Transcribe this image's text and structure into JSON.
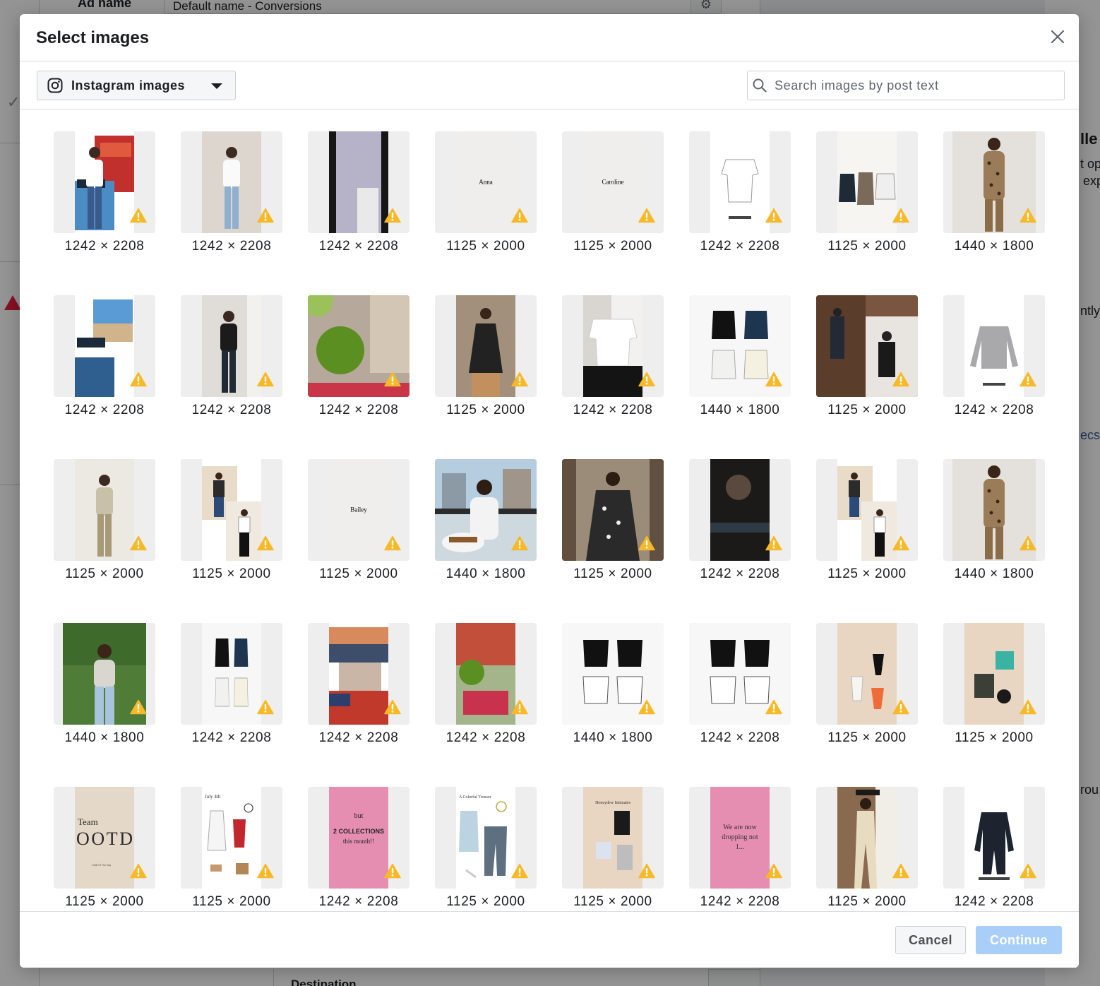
{
  "background": {
    "ad_name_label": "Ad name",
    "ad_name_value": "Default name - Conversions",
    "right_fragments": [
      "lle",
      "t op",
      "exp",
      "ntly",
      "ecs",
      "rou"
    ],
    "destination_label": "Destination"
  },
  "modal": {
    "title": "Select images",
    "source_label": "Instagram images",
    "search_placeholder": "Search images by post text",
    "cancel_label": "Cancel",
    "continue_label": "Continue"
  },
  "colors": {
    "warning": "#f7b928",
    "primary_disabled": "#a9cff9"
  },
  "images": [
    {
      "dims": "1242 × 2208",
      "bg": "#f4f4f2",
      "shape": "narrow",
      "art": "collage-fruit"
    },
    {
      "dims": "1242 × 2208",
      "bg": "#d9d2cc",
      "shape": "narrow",
      "art": "mirror-white"
    },
    {
      "dims": "1242 × 2208",
      "bg": "#b9b5c7",
      "shape": "narrow",
      "art": "lavender-top"
    },
    {
      "dims": "1125 × 2000",
      "bg": "#efeeec",
      "shape": "narrow",
      "art": "text",
      "text": "Anna"
    },
    {
      "dims": "1125 × 2000",
      "bg": "#efeeec",
      "shape": "narrow",
      "art": "text",
      "text": "Caroline"
    },
    {
      "dims": "1242 × 2208",
      "bg": "#f7f7f7",
      "shape": "narrow",
      "art": "fit-guide-white"
    },
    {
      "dims": "1125 × 2000",
      "bg": "#f5f4f1",
      "shape": "narrow",
      "art": "collection"
    },
    {
      "dims": "1440 × 1800",
      "bg": "#dcd9d5",
      "shape": "mid",
      "art": "leopard"
    },
    {
      "dims": "1242 × 2208",
      "bg": "#f4f4f2",
      "shape": "narrow",
      "art": "collage-sea"
    },
    {
      "dims": "1242 × 2208",
      "bg": "#d8d4d0",
      "shape": "narrow",
      "art": "mirror-black"
    },
    {
      "dims": "1242 × 2208",
      "bg": "#b5a59a",
      "shape": "wide",
      "art": "lime"
    },
    {
      "dims": "1125 × 2000",
      "bg": "#9b8a78",
      "shape": "narrow",
      "art": "floral-dress"
    },
    {
      "dims": "1242 × 2208",
      "bg": "#f0efed",
      "shape": "narrow",
      "art": "white-tee"
    },
    {
      "dims": "1440 × 1800",
      "bg": "#f7f7f7",
      "shape": "wide",
      "art": "tops-grid"
    },
    {
      "dims": "1125 × 2000",
      "bg": "#6f4b34",
      "shape": "wide",
      "art": "collage-brown"
    },
    {
      "dims": "1242 × 2208",
      "bg": "#f7f7f7",
      "shape": "narrow",
      "art": "grey-sweater"
    },
    {
      "dims": "1125 × 2000",
      "bg": "#e9e6e0",
      "shape": "narrow",
      "art": "mirror-khaki"
    },
    {
      "dims": "1125 × 2000",
      "bg": "#f4f4f2",
      "shape": "narrow",
      "art": "day-night"
    },
    {
      "dims": "1125 × 2000",
      "bg": "#efeeec",
      "shape": "narrow",
      "art": "text",
      "text": "Bailey"
    },
    {
      "dims": "1440 × 1800",
      "bg": "#cfd8dd",
      "shape": "wide",
      "art": "balcony"
    },
    {
      "dims": "1125 × 2000",
      "bg": "#5c4a3e",
      "shape": "wide",
      "art": "mirror-floral"
    },
    {
      "dims": "1242 × 2208",
      "bg": "#2a2624",
      "shape": "narrow",
      "art": "dark-cat"
    },
    {
      "dims": "1125 × 2000",
      "bg": "#f4f4f2",
      "shape": "narrow",
      "art": "day-night-2"
    },
    {
      "dims": "1440 × 1800",
      "bg": "#dcd9d5",
      "shape": "mid",
      "art": "leopard-dress"
    },
    {
      "dims": "1440 × 1800",
      "bg": "#4d7a3a",
      "shape": "mid",
      "art": "garden"
    },
    {
      "dims": "1242 × 2208",
      "bg": "#f7f7f7",
      "shape": "narrow",
      "art": "tops-sara"
    },
    {
      "dims": "1242 × 2208",
      "bg": "#f4f4f2",
      "shape": "narrow",
      "art": "collage-sunset"
    },
    {
      "dims": "1242 × 2208",
      "bg": "#8aa07a",
      "shape": "narrow",
      "art": "vodka"
    },
    {
      "dims": "1440 × 1800",
      "bg": "#f7f7f7",
      "shape": "wide",
      "art": "dana-grid"
    },
    {
      "dims": "1242 × 2208",
      "bg": "#f7f7f7",
      "shape": "wide",
      "art": "dana-grid-2"
    },
    {
      "dims": "1125 × 2000",
      "bg": "#e6d5c3",
      "shape": "narrow",
      "art": "swim"
    },
    {
      "dims": "1125 × 2000",
      "bg": "#e6d5c3",
      "shape": "narrow",
      "art": "girlfriend"
    },
    {
      "dims": "1125 × 2000",
      "bg": "#e3d6c6",
      "shape": "narrow",
      "art": "ootd"
    },
    {
      "dims": "1125 × 2000",
      "bg": "#ffffff",
      "shape": "narrow",
      "art": "july4"
    },
    {
      "dims": "1242 × 2208",
      "bg": "#e58eb1",
      "shape": "narrow",
      "art": "pink-collections"
    },
    {
      "dims": "1125 × 2000",
      "bg": "#ffffff",
      "shape": "narrow",
      "art": "trouser"
    },
    {
      "dims": "1125 × 2000",
      "bg": "#e6d5c3",
      "shape": "narrow",
      "art": "intimates"
    },
    {
      "dims": "1242 × 2208",
      "bg": "#e58eb1",
      "shape": "narrow",
      "art": "pink-dropping"
    },
    {
      "dims": "1125 × 2000",
      "bg": "#8a6a4f",
      "shape": "narrow",
      "art": "jumpsuit-photo"
    },
    {
      "dims": "1242 × 2208",
      "bg": "#f7f7f7",
      "shape": "narrow",
      "art": "caroline-jumpsuit"
    }
  ]
}
